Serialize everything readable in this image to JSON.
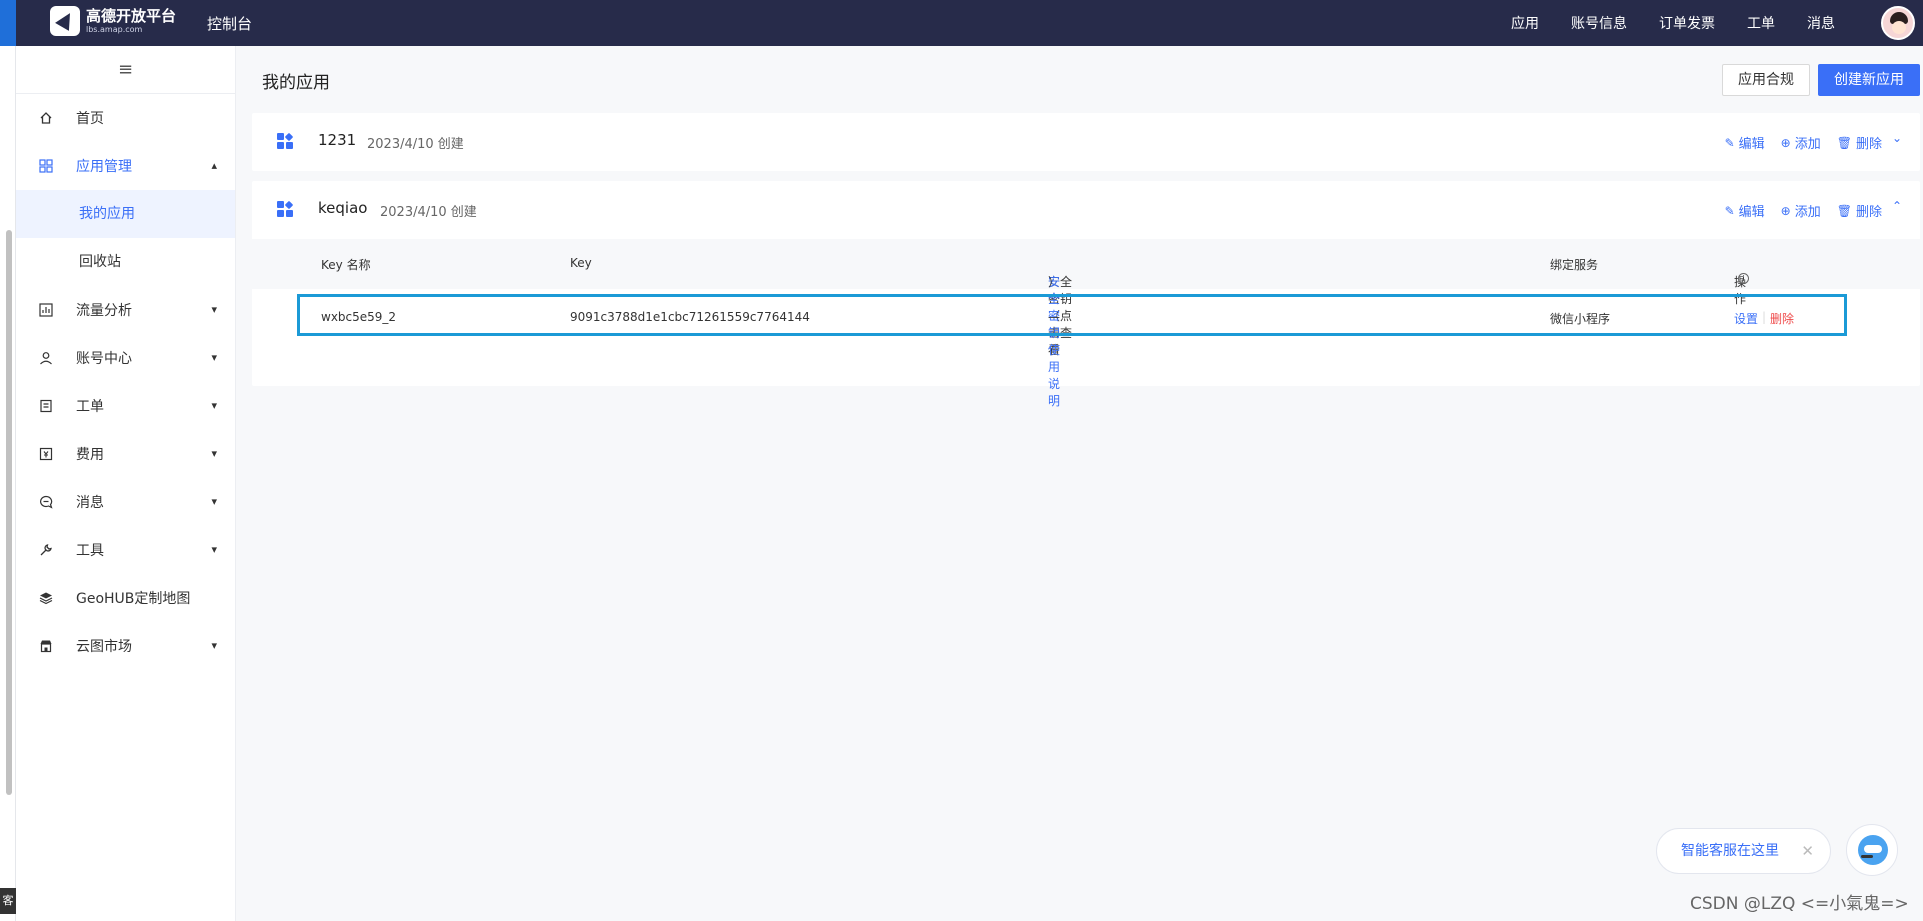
{
  "left_strip": {
    "tag": "客"
  },
  "topbar": {
    "logo_title": "高德开放平台",
    "logo_sub": "lbs.amap.com",
    "console": "控制台",
    "nav": [
      "应用",
      "账号信息",
      "订单发票",
      "工单",
      "消息"
    ]
  },
  "sidebar": {
    "collapse_icon": "≡",
    "items": [
      {
        "label": "首页",
        "icon": "home-icon"
      },
      {
        "label": "应用管理",
        "icon": "grid-icon"
      },
      {
        "label": "流量分析",
        "icon": "chart-icon"
      },
      {
        "label": "账号中心",
        "icon": "user-icon"
      },
      {
        "label": "工单",
        "icon": "ticket-icon"
      },
      {
        "label": "费用",
        "icon": "billing-icon"
      },
      {
        "label": "消息",
        "icon": "message-icon"
      },
      {
        "label": "工具",
        "icon": "wrench-icon"
      },
      {
        "label": "GeoHUB定制地图",
        "icon": "layers-icon"
      },
      {
        "label": "云图市场",
        "icon": "store-icon"
      }
    ],
    "sub_items": [
      "我的应用",
      "回收站"
    ]
  },
  "main": {
    "title": "我的应用",
    "compliance_button": "应用合规",
    "create_button": "创建新应用",
    "actions": {
      "edit": "编辑",
      "add": "添加",
      "delete": "删除"
    },
    "apps": [
      {
        "name": "1231",
        "created": "2023/4/10 创建",
        "expanded": false
      },
      {
        "name": "keqiao",
        "created": "2023/4/10 创建",
        "expanded": true
      }
    ],
    "table": {
      "headers": {
        "key_name": "Key 名称",
        "key": "Key",
        "secret_prefix": "安全密钥（点击查看",
        "secret_link": "安全密钥使用说明",
        "secret_suffix": "）",
        "service": "绑定服务",
        "ops": "操作"
      },
      "rows": [
        {
          "key_name": "wxbc5e59_2",
          "key": "9091c3788d1e1cbc71261559c7764144",
          "secret": "—",
          "service": "微信小程序",
          "op_set": "设置",
          "op_sep": "|",
          "op_delete": "删除"
        }
      ]
    }
  },
  "service": {
    "label": "智能客服在这里",
    "close": "✕"
  },
  "watermark": "CSDN @LZQ <=小氣鬼=>"
}
